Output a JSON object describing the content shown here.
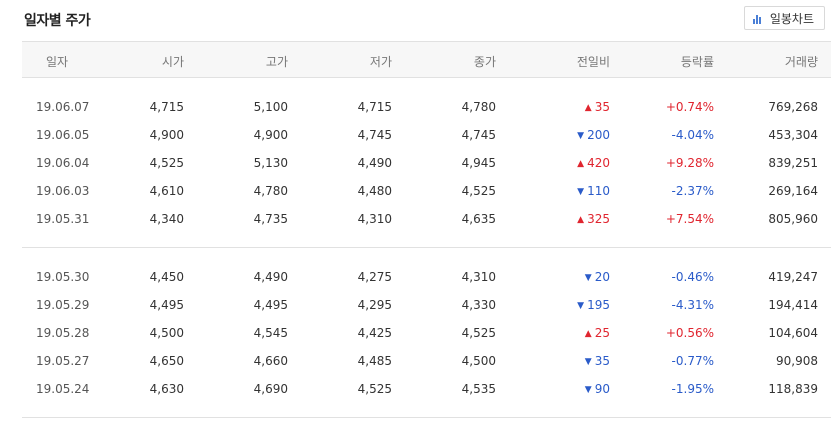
{
  "title": "일자별 주가",
  "chart_button": {
    "label": "일봉차트",
    "icon": "bar-chart-icon",
    "icon_color": "#4a7fd6"
  },
  "colors": {
    "up": "#e0252f",
    "down": "#2a5bc9"
  },
  "columns": [
    "일자",
    "시가",
    "고가",
    "저가",
    "종가",
    "전일비",
    "등락률",
    "거래량"
  ],
  "groups": [
    [
      {
        "date": "19.06.07",
        "open": "4,715",
        "high": "5,100",
        "low": "4,715",
        "close": "4,780",
        "dir": "up",
        "change": "35",
        "rate": "+0.74%",
        "volume": "769,268"
      },
      {
        "date": "19.06.05",
        "open": "4,900",
        "high": "4,900",
        "low": "4,745",
        "close": "4,745",
        "dir": "down",
        "change": "200",
        "rate": "-4.04%",
        "volume": "453,304"
      },
      {
        "date": "19.06.04",
        "open": "4,525",
        "high": "5,130",
        "low": "4,490",
        "close": "4,945",
        "dir": "up",
        "change": "420",
        "rate": "+9.28%",
        "volume": "839,251"
      },
      {
        "date": "19.06.03",
        "open": "4,610",
        "high": "4,780",
        "low": "4,480",
        "close": "4,525",
        "dir": "down",
        "change": "110",
        "rate": "-2.37%",
        "volume": "269,164"
      },
      {
        "date": "19.05.31",
        "open": "4,340",
        "high": "4,735",
        "low": "4,310",
        "close": "4,635",
        "dir": "up",
        "change": "325",
        "rate": "+7.54%",
        "volume": "805,960"
      }
    ],
    [
      {
        "date": "19.05.30",
        "open": "4,450",
        "high": "4,490",
        "low": "4,275",
        "close": "4,310",
        "dir": "down",
        "change": "20",
        "rate": "-0.46%",
        "volume": "419,247"
      },
      {
        "date": "19.05.29",
        "open": "4,495",
        "high": "4,495",
        "low": "4,295",
        "close": "4,330",
        "dir": "down",
        "change": "195",
        "rate": "-4.31%",
        "volume": "194,414"
      },
      {
        "date": "19.05.28",
        "open": "4,500",
        "high": "4,545",
        "low": "4,425",
        "close": "4,525",
        "dir": "up",
        "change": "25",
        "rate": "+0.56%",
        "volume": "104,604"
      },
      {
        "date": "19.05.27",
        "open": "4,650",
        "high": "4,660",
        "low": "4,485",
        "close": "4,500",
        "dir": "down",
        "change": "35",
        "rate": "-0.77%",
        "volume": "90,908"
      },
      {
        "date": "19.05.24",
        "open": "4,630",
        "high": "4,690",
        "low": "4,525",
        "close": "4,535",
        "dir": "down",
        "change": "90",
        "rate": "-1.95%",
        "volume": "118,839"
      }
    ]
  ]
}
